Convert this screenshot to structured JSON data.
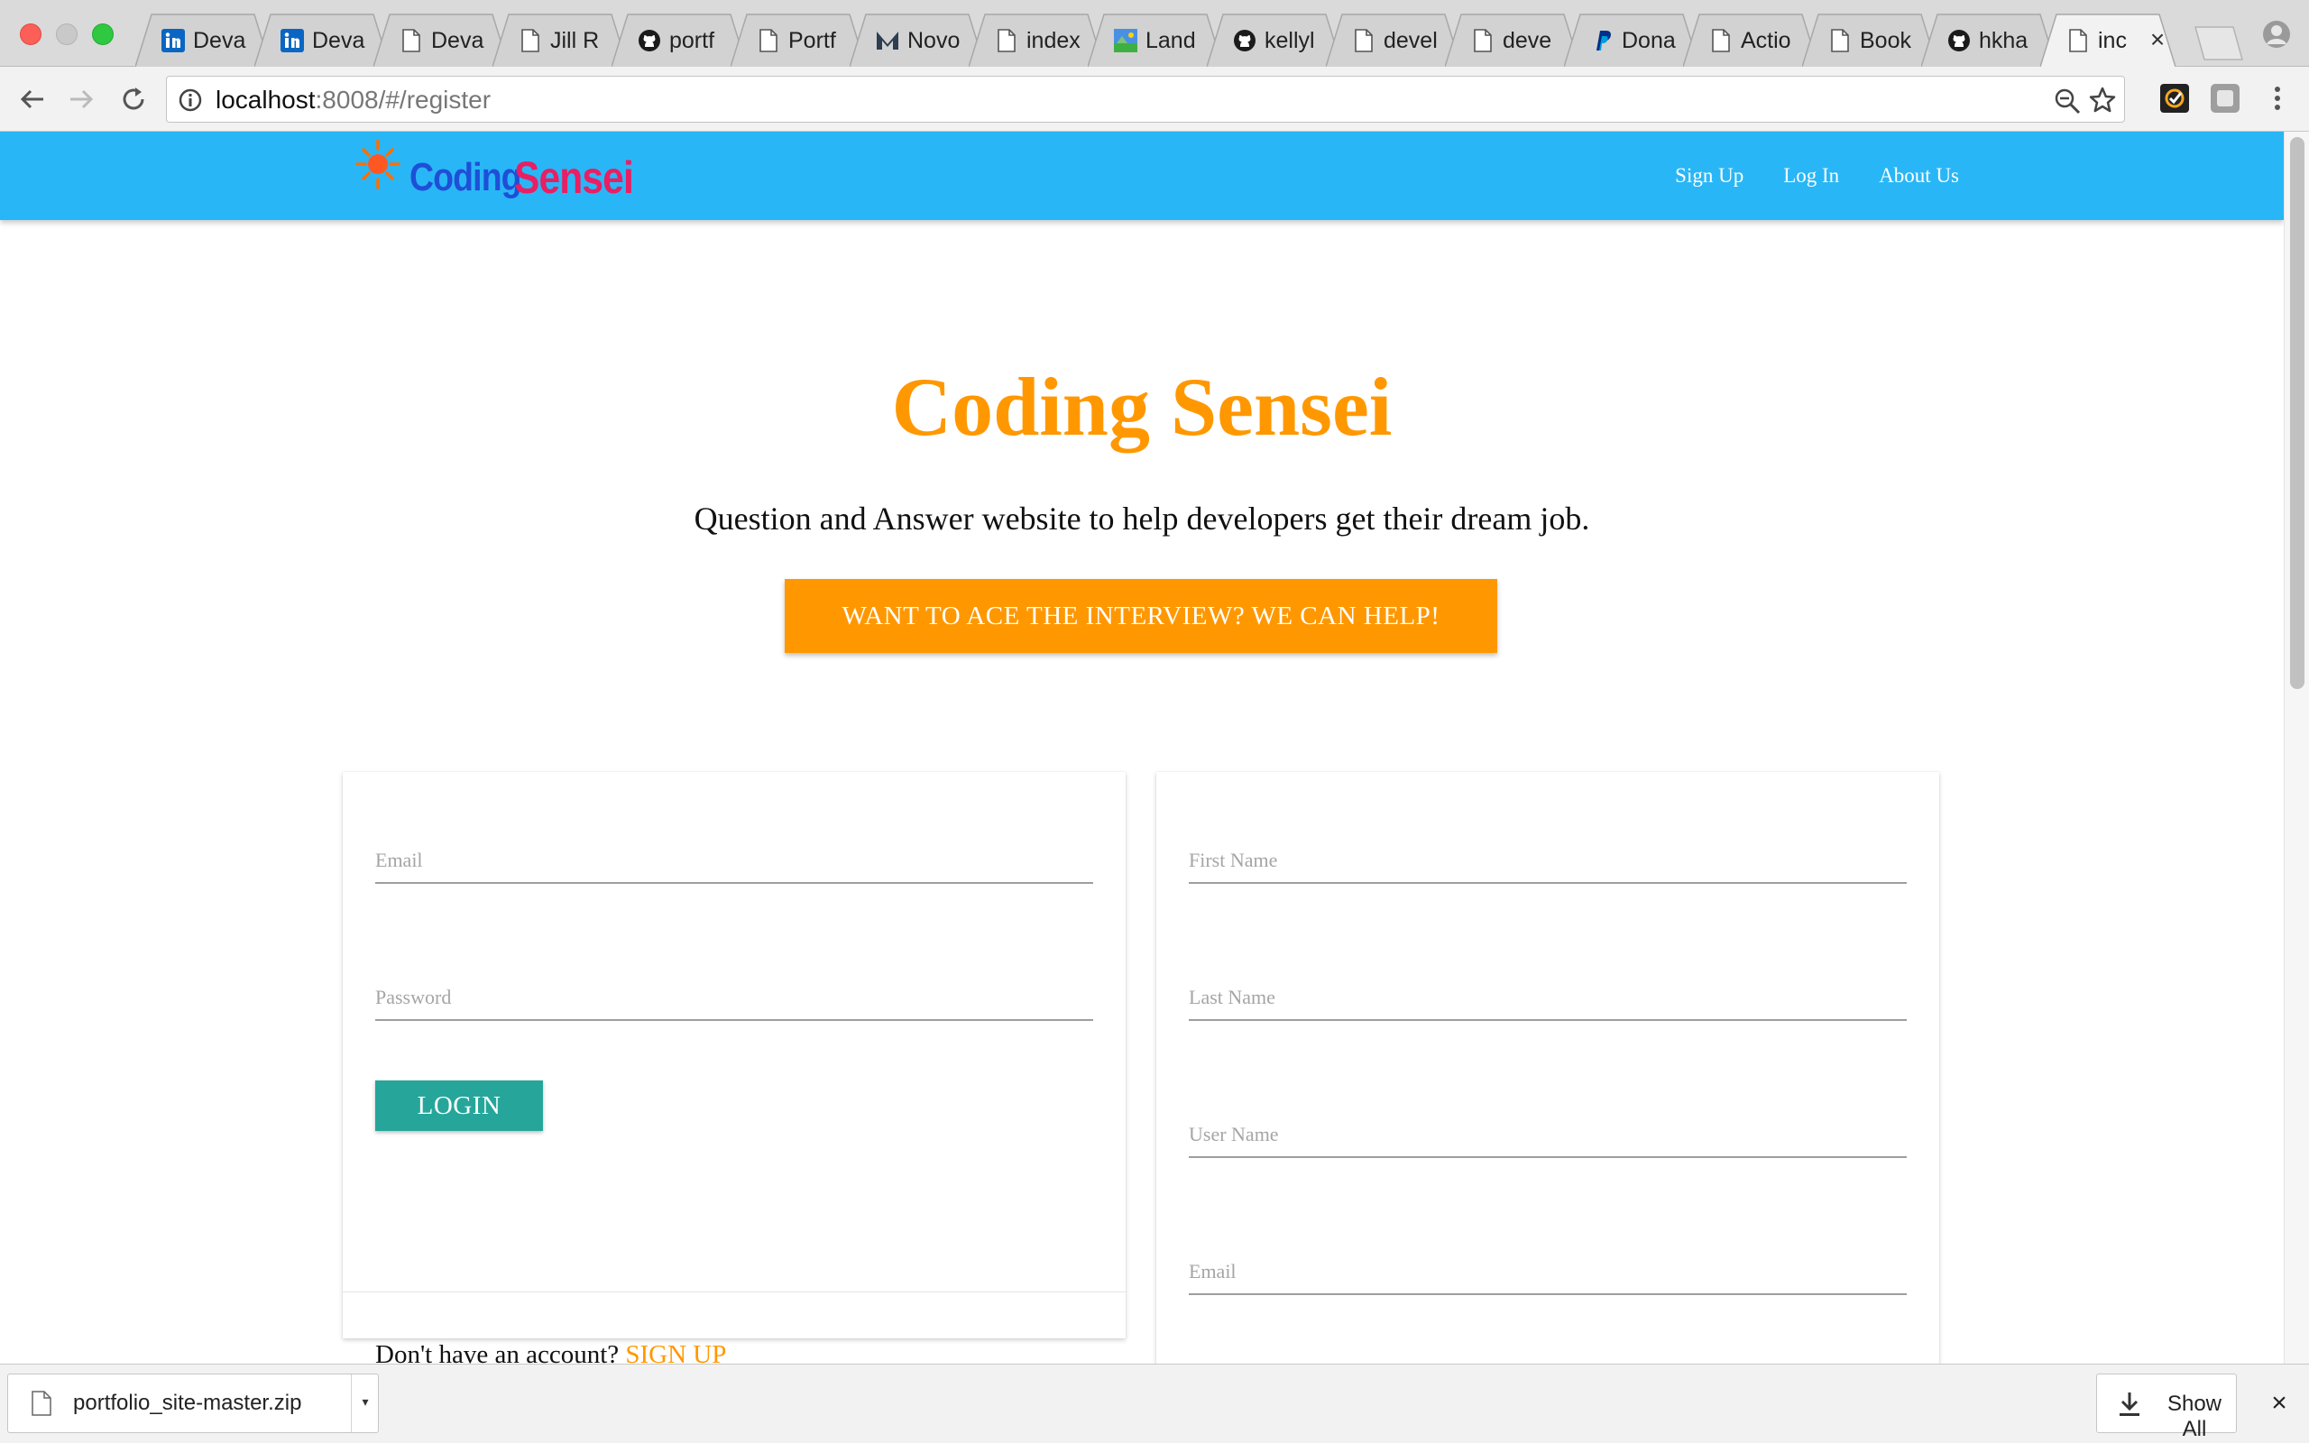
{
  "browser": {
    "tabs": [
      {
        "label": "Deva",
        "icon": "linkedin-icon"
      },
      {
        "label": "Deva",
        "icon": "linkedin-icon"
      },
      {
        "label": "Deva",
        "icon": "page-icon"
      },
      {
        "label": "Jill R",
        "icon": "page-icon"
      },
      {
        "label": "portf",
        "icon": "github-icon"
      },
      {
        "label": "Portf",
        "icon": "page-icon"
      },
      {
        "label": "Novo",
        "icon": "novo-icon"
      },
      {
        "label": "index",
        "icon": "page-icon"
      },
      {
        "label": "Land",
        "icon": "landscape-icon"
      },
      {
        "label": "kellyl",
        "icon": "github-icon"
      },
      {
        "label": "devel",
        "icon": "page-icon"
      },
      {
        "label": "deve",
        "icon": "page-icon"
      },
      {
        "label": "Dona",
        "icon": "paypal-icon"
      },
      {
        "label": "Actio",
        "icon": "page-icon"
      },
      {
        "label": "Book",
        "icon": "page-icon"
      },
      {
        "label": "hkha",
        "icon": "github-icon"
      },
      {
        "label": "inc",
        "icon": "page-icon",
        "active": true
      }
    ],
    "url_host": "localhost",
    "url_rest": ":8008/#/register"
  },
  "site": {
    "brand_part1": "Coding",
    "brand_part2": "Sensei",
    "nav": {
      "signup": "Sign Up",
      "login": "Log In",
      "about": "About Us"
    },
    "hero_title": "Coding Sensei",
    "hero_subtitle": "Question and Answer website to help developers get their dream job.",
    "cta_label": "WANT TO ACE THE INTERVIEW? WE CAN HELP!"
  },
  "login_form": {
    "email_placeholder": "Email",
    "password_placeholder": "Password",
    "login_label": "LOGIN",
    "no_account_text": "Don't have an account?",
    "signup_link": "SIGN UP"
  },
  "register_form": {
    "first_name_placeholder": "First Name",
    "last_name_placeholder": "Last Name",
    "user_name_placeholder": "User Name",
    "email_placeholder": "Email"
  },
  "downloads": {
    "filename": "portfolio_site-master.zip",
    "show_all": "Show All"
  },
  "colors": {
    "navbar": "#29b6f6",
    "accent_orange": "#ff9800",
    "login_teal": "#26a69a",
    "brand_blue": "#1e4fd8",
    "brand_pink": "#e91e63"
  }
}
